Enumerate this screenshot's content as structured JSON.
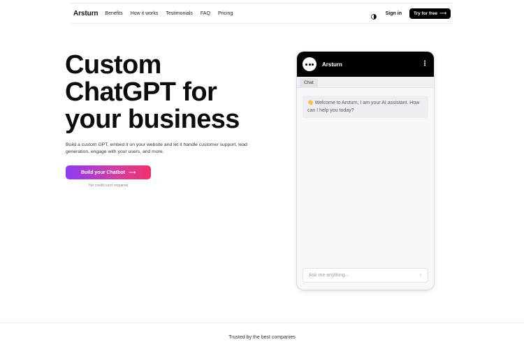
{
  "nav": {
    "logo": "Arsturn",
    "links": [
      "Benefits",
      "How it works",
      "Testimonials",
      "FAQ",
      "Pricing"
    ],
    "theme_icon": "half-moon-icon",
    "signin": "Sign in",
    "cta": "Try for free",
    "cta_arrow": "⟶"
  },
  "hero": {
    "title_lines": [
      "Custom",
      "ChatGPT for",
      "your business"
    ],
    "subtitle": "Build a custom GPT, embed it on your website and let it handle customer support, lead generation, engage with your users, and more.",
    "cta": "Build your Chatbot",
    "cta_arrow": "⟶",
    "note": "No credit card required"
  },
  "chat": {
    "name": "Arsturn",
    "menu_icon": "⋮",
    "tab": "Chat",
    "message": "👋 Welcome to Arsturn, I am your AI assistant. How can I help you today?",
    "input_placeholder": "Ask me anything...",
    "send_icon": "↑"
  },
  "footer": {
    "trusted": "Trusted by the best companies"
  }
}
